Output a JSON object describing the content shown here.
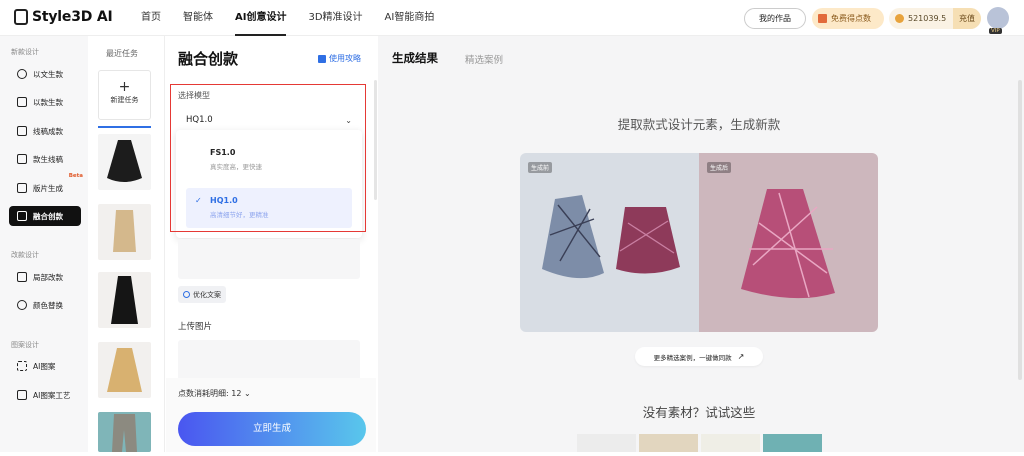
{
  "header": {
    "brand": "Style3D AI",
    "nav": [
      "首页",
      "智能体",
      "AI创意设计",
      "3D精准设计",
      "AI智能商拍"
    ],
    "my_works": "我的作品",
    "free_points": "免费得点数",
    "points": "521039.5",
    "recharge": "充值",
    "vip": "VIP"
  },
  "sidebar": {
    "groups": [
      {
        "title": "新款设计",
        "items": [
          {
            "label": "以文生款"
          },
          {
            "label": "以款生款"
          },
          {
            "label": "线稿成款"
          },
          {
            "label": "款生线稿"
          },
          {
            "label": "版片生成",
            "badge": "Beta"
          },
          {
            "label": "融合创款",
            "active": true
          }
        ]
      },
      {
        "title": "改款设计",
        "items": [
          {
            "label": "局部改款"
          },
          {
            "label": "颜色替换"
          }
        ]
      },
      {
        "title": "图案设计",
        "items": [
          {
            "label": "AI图案"
          },
          {
            "label": "AI图案工艺"
          }
        ]
      }
    ]
  },
  "tasks": {
    "title": "最近任务",
    "new_task": "新建任务",
    "new_icon": "+"
  },
  "panel": {
    "title": "融合创款",
    "guide": "使用攻略",
    "model_label": "选择模型",
    "model_value": "HQ1.0",
    "options": [
      {
        "name": "FS1.0",
        "desc": "真实度高，更快速",
        "selected": false
      },
      {
        "name": "HQ1.0",
        "desc": "高清细节好，更精准",
        "selected": true
      }
    ],
    "optimize": "优化文案",
    "upload_label": "上传图片",
    "cost_label": "点数消耗明细: 12",
    "generate": "立即生成"
  },
  "right": {
    "tabs": [
      "生成结果",
      "精选案例"
    ],
    "headline": "提取款式设计元素，生成新款",
    "before_tag": "生成前",
    "after_tag": "生成后",
    "more_cases": "更多精选案例，一键做同款",
    "no_material": "没有素材？试试这些"
  },
  "colors": {
    "accent": "#4a6cf7",
    "highlight_border": "#e53935",
    "active_item": "#111111"
  }
}
